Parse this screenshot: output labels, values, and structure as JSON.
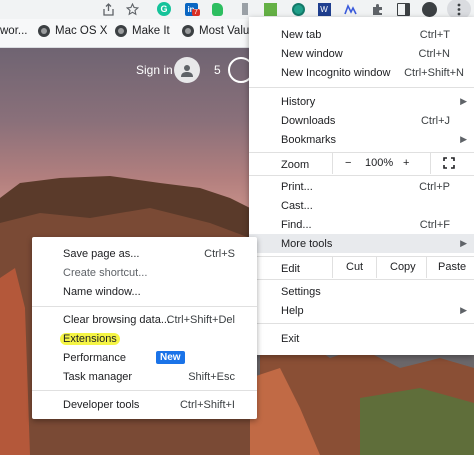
{
  "toolbar": {
    "icons": [
      "share-icon",
      "star-icon",
      "grammarly-icon",
      "linkedin-icon",
      "evernote-icon",
      "extension-icon",
      "codepen-icon",
      "word-icon",
      "chart-icon",
      "puzzle-icon",
      "sidebar-icon",
      "profile-icon",
      "kebab-icon"
    ],
    "linkedin_badge": "7"
  },
  "bookmarks": [
    {
      "label": "wor..."
    },
    {
      "label": "Mac OS X"
    },
    {
      "label": "Make It"
    },
    {
      "label": "Most Valual"
    }
  ],
  "page": {
    "signin": "Sign in",
    "reward_count": "5"
  },
  "menu": {
    "items": [
      {
        "label": "New tab",
        "shortcut": "Ctrl+T"
      },
      {
        "label": "New window",
        "shortcut": "Ctrl+N"
      },
      {
        "label": "New Incognito window",
        "shortcut": "Ctrl+Shift+N"
      },
      {
        "label": "History",
        "shortcut": ""
      },
      {
        "label": "Downloads",
        "shortcut": "Ctrl+J"
      },
      {
        "label": "Bookmarks",
        "shortcut": ""
      },
      {
        "label": "Print...",
        "shortcut": "Ctrl+P"
      },
      {
        "label": "Cast...",
        "shortcut": ""
      },
      {
        "label": "Find...",
        "shortcut": "Ctrl+F"
      },
      {
        "label": "More tools",
        "shortcut": ""
      },
      {
        "label": "Settings",
        "shortcut": ""
      },
      {
        "label": "Help",
        "shortcut": ""
      },
      {
        "label": "Exit",
        "shortcut": ""
      }
    ],
    "zoom": {
      "label": "Zoom",
      "minus": "−",
      "value": "100%",
      "plus": "+"
    },
    "edit": {
      "label": "Edit",
      "cut": "Cut",
      "copy": "Copy",
      "paste": "Paste"
    }
  },
  "submenu": {
    "items": [
      {
        "label": "Save page as...",
        "shortcut": "Ctrl+S"
      },
      {
        "label": "Create shortcut...",
        "shortcut": ""
      },
      {
        "label": "Name window...",
        "shortcut": ""
      },
      {
        "label": "Clear browsing data...",
        "shortcut": "Ctrl+Shift+Del"
      },
      {
        "label": "Extensions",
        "shortcut": ""
      },
      {
        "label": "Performance",
        "shortcut": ""
      },
      {
        "label": "Task manager",
        "shortcut": "Shift+Esc"
      },
      {
        "label": "Developer tools",
        "shortcut": "Ctrl+Shift+I"
      }
    ],
    "new_badge": "New"
  },
  "colors": {
    "accent": "#1a73e8",
    "highlight": "#f5f545",
    "menu_hover": "#e8eaed"
  }
}
